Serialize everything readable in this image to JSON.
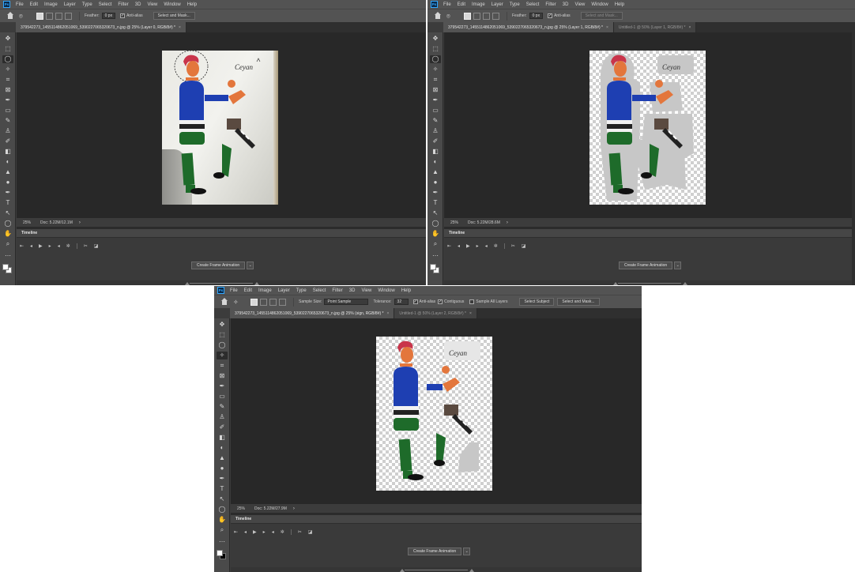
{
  "menu": [
    "File",
    "Edit",
    "Image",
    "Layer",
    "Type",
    "Select",
    "Filter",
    "3D",
    "View",
    "Window",
    "Help"
  ],
  "ps_logo": "Ps",
  "icons": {
    "tool_glyphs": [
      "✥",
      "⬚",
      "◯",
      "✧",
      "⌗",
      "⊠",
      "✒",
      "▭",
      "✎",
      "♙",
      "✐",
      "◧",
      "◐",
      "▲",
      "●",
      "✒",
      "T",
      "↖",
      "◯",
      "✋",
      "⌕"
    ]
  },
  "windows": [
    {
      "options": {
        "feather_label": "Feather:",
        "feather_value": "0 px",
        "antialias_label": "Anti-alias",
        "select_mask": "Select and Mask..."
      },
      "tabs": [
        {
          "label": "379542273_1455114862051069_5390227065320673_n.jpg @ 25% (Layer 0, RGB/8#) *",
          "close": "×"
        }
      ],
      "status": {
        "zoom": "25%",
        "doc": "Doc: 5.22M/12.1M"
      },
      "timeline": {
        "title": "Timeline",
        "button": "Create Frame Animation"
      },
      "watermark": "Ceyan"
    },
    {
      "options": {
        "feather_label": "Feather:",
        "feather_value": "0 px",
        "antialias_label": "Anti-alias",
        "select_mask": "Select and Mask..."
      },
      "tabs": [
        {
          "label": "379542273_1455114862051069_5390227065320673_n.jpg @ 25% (Layer 1, RGB/8#) *",
          "close": "×"
        },
        {
          "label": "Untitled-1 @ 50% (Layer 1, RGB/8#) *",
          "close": "×"
        }
      ],
      "status": {
        "zoom": "25%",
        "doc": "Doc: 5.22M/28.6M"
      },
      "timeline": {
        "title": "Timeline",
        "button": "Create Frame Animation"
      },
      "watermark": "Ceyan"
    },
    {
      "options": {
        "sample_size_label": "Sample Size:",
        "sample_size_value": "Point Sample",
        "tolerance_label": "Tolerance:",
        "tolerance_value": "32",
        "antialias_label": "Anti-alias",
        "contiguous_label": "Contiguous",
        "sample_all_label": "Sample All Layers",
        "select_subject": "Select Subject",
        "select_mask": "Select and Mask..."
      },
      "tabs": [
        {
          "label": "379542273_1455114862051069_5390227065320673_n.jpg @ 25% (sign, RGB/8#) *",
          "close": "×"
        },
        {
          "label": "Untitled-1 @ 50% (Layer 2, RGB/8#) *",
          "close": "×"
        }
      ],
      "status": {
        "zoom": "25%",
        "doc": "Doc: 5.22M/27.9M"
      },
      "timeline": {
        "title": "Timeline",
        "button": "Create Frame Animation"
      },
      "watermark": "Ceyan"
    }
  ]
}
